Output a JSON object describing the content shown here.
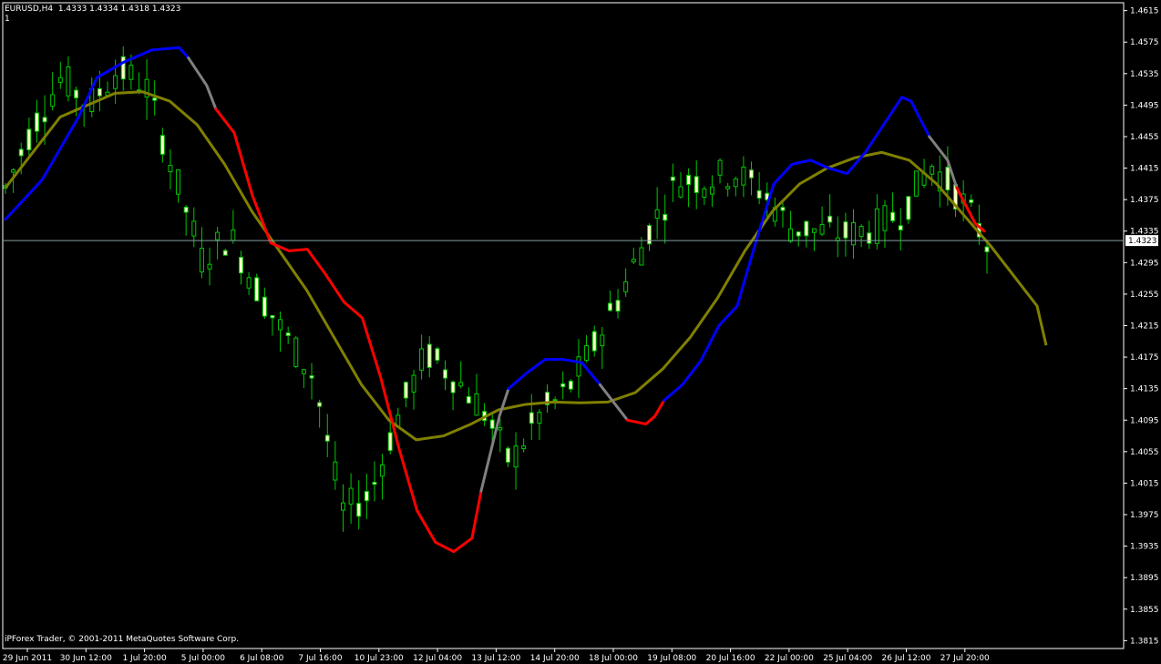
{
  "header": {
    "symbol_line": "EURUSD,H4  1.4333 1.4334 1.4318 1.4323",
    "indicator_line": "1"
  },
  "footer": {
    "copyright": "iPForex Trader, © 2001-2011 MetaQuotes Software Corp."
  },
  "colors": {
    "background": "#000000",
    "frame": "#ffffff",
    "candle_up_body": "#000000",
    "candle_down_body": "#ffffc8",
    "wick": "#00c800",
    "ma_trend_up": "#0000ff",
    "ma_trend_down": "#ff0000",
    "ma_flat": "#808080",
    "slow_ma": "#808000",
    "current_price_line": "#7f9f9f"
  },
  "chart_data": {
    "type": "candlestick",
    "symbol": "EURUSD",
    "timeframe": "H4",
    "ohlc_current": {
      "open": 1.4333,
      "high": 1.4334,
      "low": 1.4318,
      "close": 1.4323
    },
    "current_price_label": "1.4323",
    "ylim": [
      1.3805,
      1.4625
    ],
    "y_ticks": [
      "1.4615",
      "1.4575",
      "1.4535",
      "1.4495",
      "1.4455",
      "1.4415",
      "1.4375",
      "1.4335",
      "1.4295",
      "1.4255",
      "1.4215",
      "1.4175",
      "1.4135",
      "1.4095",
      "1.4055",
      "1.4015",
      "1.3975",
      "1.3935",
      "1.3895",
      "1.3855",
      "1.3815"
    ],
    "x_ticks": [
      "29 Jun 2011",
      "30 Jun 12:00",
      "1 Jul 20:00",
      "5 Jul 00:00",
      "6 Jul 08:00",
      "7 Jul 16:00",
      "10 Jul 23:00",
      "12 Jul 04:00",
      "13 Jul 12:00",
      "14 Jul 20:00",
      "18 Jul 00:00",
      "19 Jul 08:00",
      "20 Jul 16:00",
      "22 Jul 00:00",
      "25 Jul 04:00",
      "26 Jul 12:00",
      "27 Jul 20:00"
    ],
    "bar_count": 126,
    "candle_keypoints": [
      [
        0,
        1.439
      ],
      [
        6,
        1.447
      ],
      [
        12,
        1.453
      ],
      [
        18,
        1.4495
      ],
      [
        24,
        1.454
      ],
      [
        30,
        1.452
      ],
      [
        36,
        1.441
      ],
      [
        42,
        1.43
      ],
      [
        48,
        1.433
      ],
      [
        54,
        1.426
      ],
      [
        60,
        1.42
      ],
      [
        66,
        1.415
      ],
      [
        72,
        1.398
      ],
      [
        78,
        1.4
      ],
      [
        84,
        1.41
      ],
      [
        90,
        1.418
      ],
      [
        96,
        1.415
      ],
      [
        102,
        1.411
      ],
      [
        108,
        1.404
      ],
      [
        114,
        1.41
      ],
      [
        120,
        1.413
      ],
      [
        126,
        1.419
      ],
      [
        132,
        1.426
      ],
      [
        138,
        1.434
      ],
      [
        144,
        1.44
      ],
      [
        150,
        1.44
      ],
      [
        156,
        1.441
      ],
      [
        162,
        1.4385
      ],
      [
        168,
        1.434
      ],
      [
        174,
        1.4335
      ],
      [
        180,
        1.433
      ],
      [
        186,
        1.434
      ],
      [
        192,
        1.436
      ],
      [
        198,
        1.442
      ],
      [
        204,
        1.438
      ],
      [
        210,
        1.432
      ]
    ],
    "fast_ma_segments": [
      {
        "color": "blue",
        "points": [
          [
            0,
            1.435
          ],
          [
            4,
            1.44
          ],
          [
            8,
            1.448
          ],
          [
            10,
            1.453
          ],
          [
            13,
            1.455
          ],
          [
            16,
            1.4565
          ],
          [
            19,
            1.4568
          ],
          [
            20,
            1.4555
          ]
        ]
      },
      {
        "color": "gray",
        "points": [
          [
            20,
            1.4555
          ],
          [
            22,
            1.452
          ],
          [
            23,
            1.449
          ]
        ]
      },
      {
        "color": "red",
        "points": [
          [
            23,
            1.449
          ],
          [
            25,
            1.446
          ],
          [
            27,
            1.438
          ],
          [
            29,
            1.432
          ],
          [
            31,
            1.431
          ],
          [
            33,
            1.4312
          ],
          [
            35,
            1.428
          ],
          [
            37,
            1.4245
          ],
          [
            39,
            1.4225
          ],
          [
            41,
            1.415
          ],
          [
            43,
            1.406
          ],
          [
            45,
            1.398
          ],
          [
            47,
            1.394
          ],
          [
            49,
            1.3928
          ],
          [
            51,
            1.3945
          ],
          [
            52,
            1.4005
          ]
        ]
      },
      {
        "color": "gray",
        "points": [
          [
            52,
            1.4005
          ],
          [
            54,
            1.41
          ],
          [
            55,
            1.4135
          ]
        ]
      },
      {
        "color": "blue",
        "points": [
          [
            55,
            1.4135
          ],
          [
            57,
            1.4155
          ],
          [
            59,
            1.4172
          ],
          [
            61,
            1.4172
          ],
          [
            63,
            1.4168
          ],
          [
            65,
            1.414
          ]
        ]
      },
      {
        "color": "gray",
        "points": [
          [
            65,
            1.414
          ],
          [
            67,
            1.411
          ],
          [
            68,
            1.4095
          ]
        ]
      },
      {
        "color": "red",
        "points": [
          [
            68,
            1.4095
          ],
          [
            70,
            1.409
          ],
          [
            71,
            1.41
          ],
          [
            72,
            1.412
          ]
        ]
      },
      {
        "color": "blue",
        "points": [
          [
            72,
            1.412
          ],
          [
            74,
            1.414
          ],
          [
            76,
            1.417
          ],
          [
            78,
            1.4215
          ],
          [
            80,
            1.424
          ],
          [
            82,
            1.432
          ],
          [
            84,
            1.4395
          ],
          [
            86,
            1.442
          ],
          [
            88,
            1.4425
          ],
          [
            90,
            1.4415
          ],
          [
            92,
            1.4408
          ],
          [
            94,
            1.4435
          ],
          [
            96,
            1.447
          ],
          [
            98,
            1.4505
          ],
          [
            99,
            1.45
          ],
          [
            101,
            1.4455
          ]
        ]
      },
      {
        "color": "gray",
        "points": [
          [
            101,
            1.4455
          ],
          [
            103,
            1.4425
          ],
          [
            104,
            1.439
          ]
        ]
      },
      {
        "color": "red",
        "points": [
          [
            104,
            1.439
          ],
          [
            106,
            1.4345
          ],
          [
            107,
            1.4335
          ]
        ]
      }
    ],
    "slow_ma": [
      [
        0,
        1.439
      ],
      [
        6,
        1.448
      ],
      [
        12,
        1.451
      ],
      [
        15,
        1.4512
      ],
      [
        18,
        1.45
      ],
      [
        21,
        1.447
      ],
      [
        24,
        1.442
      ],
      [
        27,
        1.436
      ],
      [
        30,
        1.431
      ],
      [
        33,
        1.426
      ],
      [
        36,
        1.42
      ],
      [
        39,
        1.414
      ],
      [
        42,
        1.4095
      ],
      [
        45,
        1.407
      ],
      [
        48,
        1.4075
      ],
      [
        51,
        1.409
      ],
      [
        54,
        1.4108
      ],
      [
        57,
        1.4115
      ],
      [
        60,
        1.4118
      ],
      [
        63,
        1.4117
      ],
      [
        66,
        1.4118
      ],
      [
        69,
        1.413
      ],
      [
        72,
        1.416
      ],
      [
        75,
        1.42
      ],
      [
        78,
        1.425
      ],
      [
        81,
        1.431
      ],
      [
        84,
        1.436
      ],
      [
        87,
        1.4395
      ],
      [
        90,
        1.4415
      ],
      [
        93,
        1.4428
      ],
      [
        96,
        1.4435
      ],
      [
        99,
        1.4425
      ],
      [
        102,
        1.4395
      ],
      [
        105,
        1.4355
      ],
      [
        108,
        1.4315
      ],
      [
        111,
        1.427
      ],
      [
        113,
        1.424
      ],
      [
        114,
        1.419
      ]
    ]
  }
}
